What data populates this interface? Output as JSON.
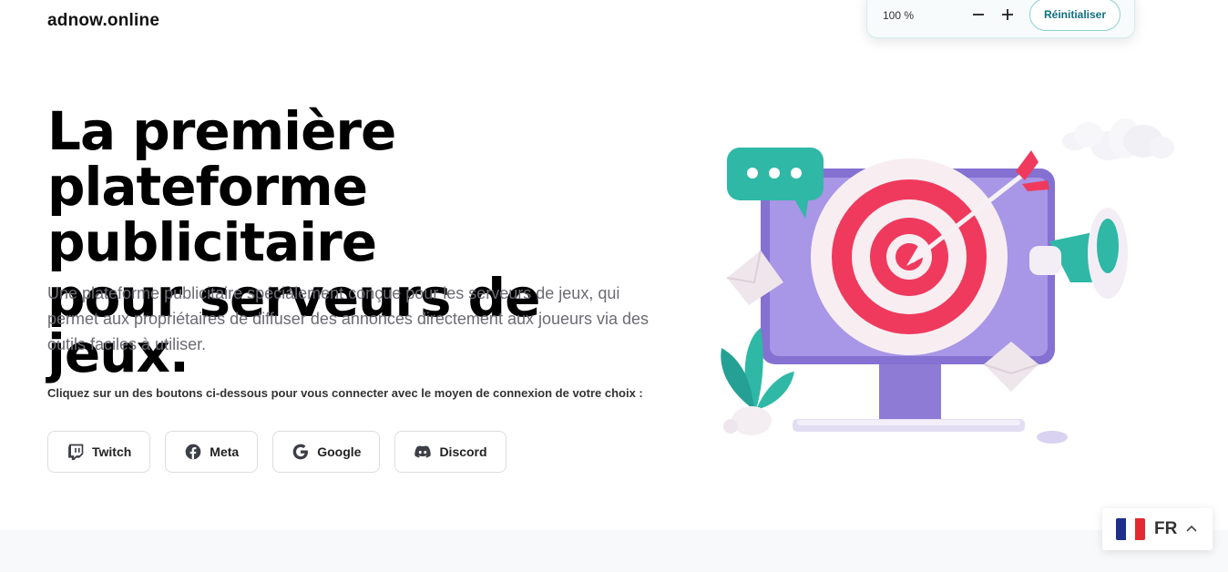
{
  "brand": {
    "name": "adnow.online"
  },
  "zoom": {
    "level": "100 %",
    "reset_label": "Réinitialiser",
    "minus_icon": "minus-icon",
    "plus_icon": "plus-icon"
  },
  "hero": {
    "title_line1": "La première",
    "title_line2": "plateforme publicitaire",
    "title_line3": "pour serveurs de jeux.",
    "subtitle": "Une plateforme publicitaire spécialement conçue pour les serveurs de jeux, qui permet aux propriétaires de diffuser des annonces directement aux joueurs via des outils faciles à utiliser.",
    "hint": "Cliquez sur un des boutons ci-dessous pour vous connecter avec le moyen de connexion de votre choix :"
  },
  "login_buttons": [
    {
      "label": "Twitch",
      "icon": "twitch-icon"
    },
    {
      "label": "Meta",
      "icon": "facebook-icon"
    },
    {
      "label": "Google",
      "icon": "google-icon"
    },
    {
      "label": "Discord",
      "icon": "discord-icon"
    }
  ],
  "language": {
    "code": "FR",
    "flag_icon": "france-flag-icon",
    "chevron_icon": "chevron-up-icon"
  },
  "colors": {
    "accent_teal": "#0e6f80",
    "target_red": "#ef3a5d",
    "monitor_purple": "#9b88e0"
  }
}
